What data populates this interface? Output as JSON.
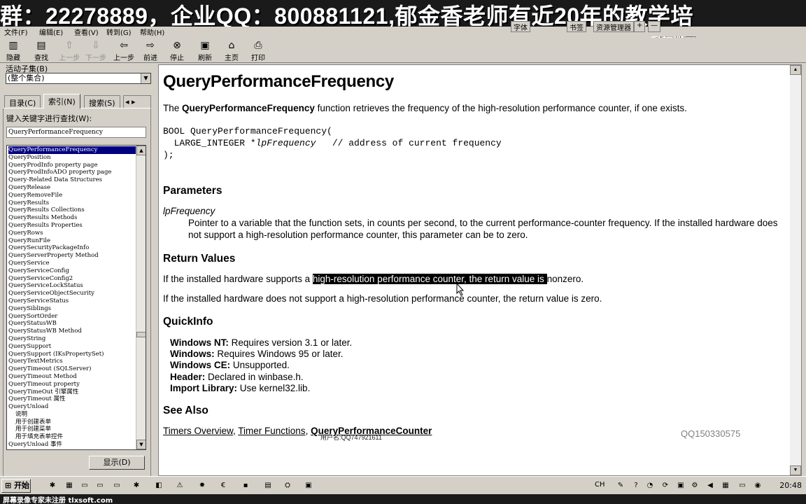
{
  "banner": {
    "text": "群：22278889，企业QQ：800881121,郁金香老师有近20年的教学培"
  },
  "watermark": "教程协会",
  "menu": {
    "file": "文件(F)",
    "edit": "编辑(E)",
    "view": "查看(V)",
    "goto": "转到(G)",
    "help": "帮助(H)"
  },
  "toolbar": {
    "hide": "隐藏",
    "find": "查找",
    "back_disabled": "上一步",
    "forward_disabled": "下一步",
    "back": "上一步",
    "forward": "前进",
    "stop": "停止",
    "refresh": "刷新",
    "home": "主页",
    "print": "打印"
  },
  "top_right": {
    "b1": "字体",
    "b2": "书签",
    "b3": "资源管理器",
    "b4": "+",
    "b5": "—"
  },
  "left_pane": {
    "subset_label": "活动子集(B)",
    "subset_value": "(整个集合)",
    "tabs": {
      "contents": "目录(C)",
      "index": "索引(N)",
      "search": "搜索(S)"
    },
    "keyword_label": "键入关键字进行查找(W):",
    "keyword_value": "QueryPerformanceFrequency",
    "display_button": "显示(D)",
    "index_items": [
      "QueryPerformanceFrequency",
      "QueryPosition",
      "QueryProdInfo property page",
      "QueryProdInfoADO property page",
      "Query-Related Data Structures",
      "QueryRelease",
      "QueryRemoveFile",
      "QueryResults",
      "QueryResults Collections",
      "QueryResults Methods",
      "QueryResults Properties",
      "QueryRows",
      "QueryRunFile",
      "QuerySecurityPackageInfo",
      "QueryServerProperty Method",
      "QueryService",
      "QueryServiceConfig",
      "QueryServiceConfig2",
      "QueryServiceLockStatus",
      "QueryServiceObjectSecurity",
      "QueryServiceStatus",
      "QuerySiblings",
      "QuerySortOrder",
      "QueryStatusWB",
      "QueryStatusWB Method",
      "QueryString",
      "QuerySupport",
      "QuerySupport (IKsPropertySet)",
      "QueryTextMetrics",
      "QueryTimeout (SQLServer)",
      "QueryTimeout Method",
      "QueryTimeout property",
      "QueryTimeOut 引擎属性",
      "QueryTimeout 属性",
      "QueryUnload",
      "说明",
      "用于创建表单",
      "用于创建菜单",
      "用于填充表单控件",
      "QueryUnload 事件"
    ]
  },
  "content": {
    "title": "QueryPerformanceFrequency",
    "intro_prefix": "The ",
    "intro_bold": "QueryPerformanceFrequency",
    "intro_suffix": " function retrieves the frequency of the high-resolution performance counter, if one exists.",
    "code_line1": "BOOL QueryPerformanceFrequency(",
    "code_line2_prefix": "  LARGE_INTEGER *",
    "code_line2_param": "lpFrequency",
    "code_line2_comment": "   // address of current frequency",
    "code_line3": ");",
    "parameters_heading": "Parameters",
    "param_name": "lpFrequency",
    "param_desc": "Pointer to a variable that the function sets, in counts per second, to the current performance-counter frequency. If the installed hardware does not support a high-resolution performance counter, this parameter can be to zero.",
    "return_heading": "Return Values",
    "ret1_prefix": "If the installed hardware supports a ",
    "ret1_highlight": "high-resolution performance counter, the return value is ",
    "ret1_suffix": "nonzero.",
    "ret2": "If the installed hardware does not support a high-resolution performance counter, the return value is zero.",
    "quickinfo_heading": "QuickInfo",
    "quickinfo": [
      {
        "label": "Windows NT:",
        "value": " Requires version 3.1 or later."
      },
      {
        "label": "Windows:",
        "value": " Requires Windows 95 or later."
      },
      {
        "label": "Windows CE:",
        "value": " Unsupported."
      },
      {
        "label": "Header:",
        "value": " Declared in winbase.h."
      },
      {
        "label": "Import Library:",
        "value": " Use kernel32.lib."
      }
    ],
    "seealso_heading": "See Also",
    "link1": "Timers Overview",
    "link2": "Timer Functions",
    "link3": "QueryPerformanceCounter",
    "qq_note": "QQ150330575",
    "user_note": "用户名:QQ747921611"
  },
  "taskbar": {
    "start": "开始",
    "lang": "CH",
    "clock": "20:48"
  },
  "footer": {
    "text": "屏幕录像专家未注册 tlxsoft.com"
  }
}
